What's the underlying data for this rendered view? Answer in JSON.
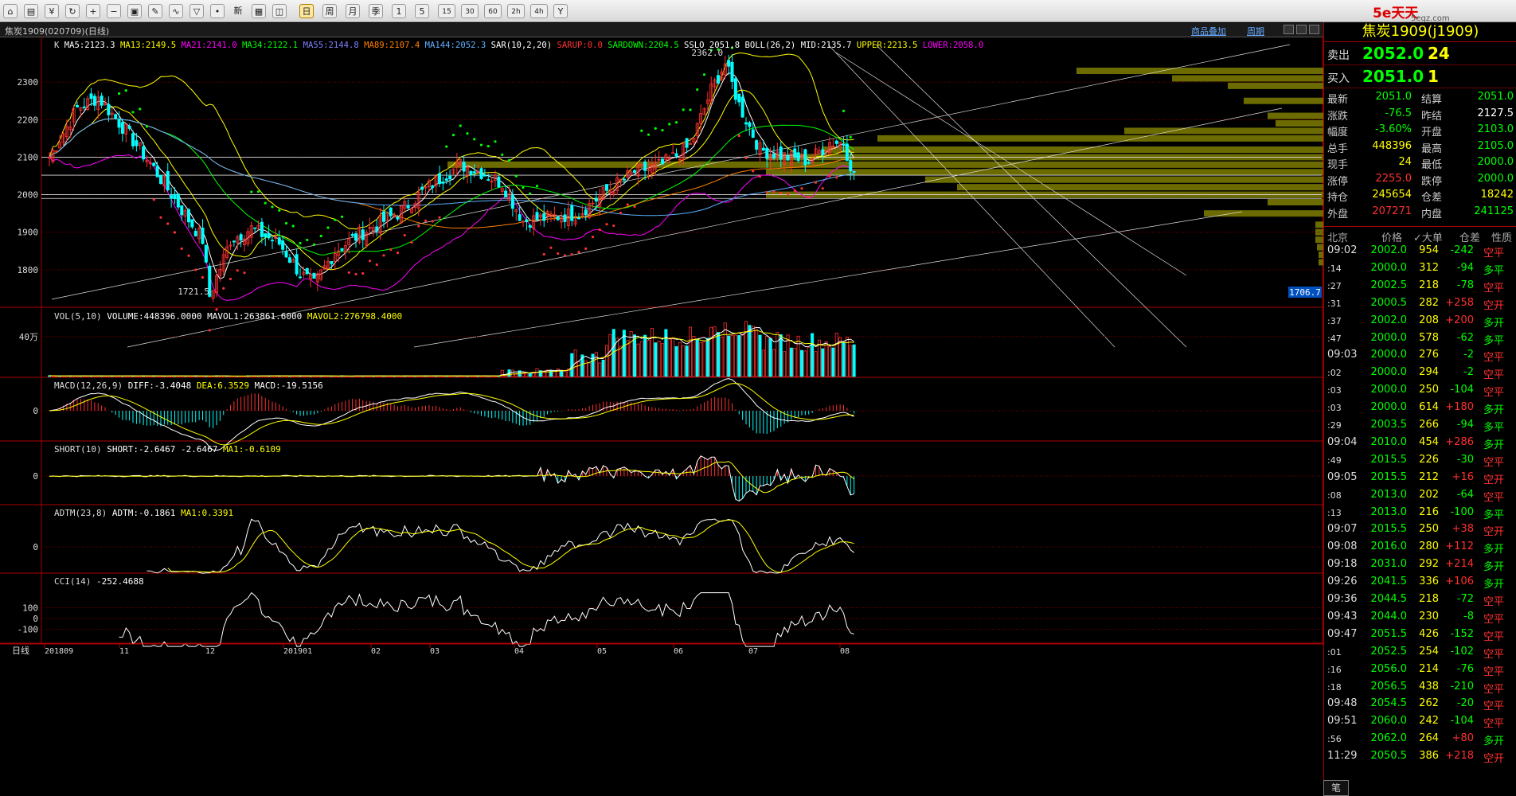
{
  "toolbar": {
    "icons": [
      "home-icon",
      "folder-icon",
      "money-icon",
      "refresh-icon",
      "zoom-in-icon",
      "zoom-out-icon",
      "window-icon",
      "pen-icon",
      "analysis-icon",
      "filter-icon",
      "news-icon",
      "table-icon",
      "multi-chart-icon"
    ],
    "periods": [
      "日",
      "周",
      "月",
      "季",
      "1",
      "5",
      "15",
      "30",
      "60",
      "2h",
      "4h",
      "Y"
    ],
    "selected_period": "日",
    "news_label": "新"
  },
  "logo": {
    "text": "5e天天",
    "domain": "5eqz.com"
  },
  "titlebar": {
    "title": "焦炭1909(020709)(日线)",
    "overlay_link": "商品叠加",
    "cycle_link": "周期"
  },
  "main_panel": {
    "indicator_line_prefix": "K",
    "indicators": [
      {
        "text": "MA5:2123.3",
        "color": "#ffffff"
      },
      {
        "text": "MA13:2149.5",
        "color": "#ffff00"
      },
      {
        "text": "MA21:2141.0",
        "color": "#ff00ff"
      },
      {
        "text": "MA34:2122.1",
        "color": "#00ff00"
      },
      {
        "text": "MA55:2144.8",
        "color": "#7f7fff"
      },
      {
        "text": "MA89:2107.4",
        "color": "#ff8000"
      },
      {
        "text": "MA144:2052.3",
        "color": "#5fb0ff"
      },
      {
        "text": "SAR(10,2,20)",
        "color": "#ffffff"
      },
      {
        "text": "SARUP:0.0",
        "color": "#ff3030"
      },
      {
        "text": "SARDOWN:2204.5",
        "color": "#00ff00"
      },
      {
        "text": "SSLO 2051.8",
        "color": "#ffffff"
      },
      {
        "text": "BOLL(26,2)",
        "color": "#ffffff"
      },
      {
        "text": "MID:2135.7",
        "color": "#ffffff"
      },
      {
        "text": "UPPER:2213.5",
        "color": "#ffff00"
      },
      {
        "text": "LOWER:2058.0",
        "color": "#ff00ff"
      }
    ],
    "y_ticks": [
      "2300",
      "2200",
      "2100",
      "2000",
      "1900",
      "1800"
    ],
    "high_label": "2362.0",
    "low_label": "1721.5",
    "cursor_price": "1706.7"
  },
  "vol_panel": {
    "label": "VOL(5,10)",
    "items": [
      {
        "text": "VOLUME:448396.0000",
        "color": "#ffffff"
      },
      {
        "text": "MAVOL1:263861.6000",
        "color": "#ffffff"
      },
      {
        "text": "MAVOL2:276798.4000",
        "color": "#ffff00"
      }
    ],
    "y_tick": "40万"
  },
  "macd_panel": {
    "label": "MACD(12,26,9)",
    "items": [
      {
        "text": "DIFF:-3.4048",
        "color": "#ffffff"
      },
      {
        "text": "DEA:6.3529",
        "color": "#ffff00"
      },
      {
        "text": "MACD:-19.5156",
        "color": "#ffffff"
      }
    ],
    "y_tick": "0"
  },
  "short_panel": {
    "label": "SHORT(10)",
    "items": [
      {
        "text": "SHORT:-2.6467",
        "color": "#ffffff"
      },
      {
        "text": "-2.6467",
        "color": "#ffffff"
      },
      {
        "text": "MA1:-0.6109",
        "color": "#ffff00"
      }
    ],
    "y_tick": "0"
  },
  "adtm_panel": {
    "label": "ADTM(23,8)",
    "items": [
      {
        "text": "ADTM:-0.1861",
        "color": "#ffffff"
      },
      {
        "text": "MA1:0.3391",
        "color": "#ffff00"
      }
    ],
    "y_tick": "0"
  },
  "cci_panel": {
    "label": "CCI(14)",
    "items": [
      {
        "text": "-252.4688",
        "color": "#ffffff"
      }
    ],
    "y_ticks": [
      "100",
      "0",
      "-100"
    ]
  },
  "x_axis": {
    "prefix": "日线",
    "labels": [
      "201809",
      "11",
      "12",
      "201901",
      "02",
      "03",
      "04",
      "05",
      "06",
      "07",
      "08"
    ]
  },
  "quote": {
    "title": "焦炭1909(j1909)",
    "sell": {
      "label": "卖出",
      "price": "2052.0",
      "vol": "24"
    },
    "buy": {
      "label": "买入",
      "price": "2051.0",
      "vol": "1"
    },
    "stats": [
      {
        "l1": "最新",
        "v1": "2051.0",
        "c1": "#00ff00",
        "l2": "结算",
        "v2": "2051.0",
        "c2": "#00ff00"
      },
      {
        "l1": "涨跌",
        "v1": "-76.5",
        "c1": "#00ff00",
        "l2": "昨结",
        "v2": "2127.5",
        "c2": "#ffffff"
      },
      {
        "l1": "幅度",
        "v1": "-3.60%",
        "c1": "#00ff00",
        "l2": "开盘",
        "v2": "2103.0",
        "c2": "#00ff00"
      },
      {
        "l1": "总手",
        "v1": "448396",
        "c1": "#ffff00",
        "l2": "最高",
        "v2": "2105.0",
        "c2": "#00ff00"
      },
      {
        "l1": "现手",
        "v1": "24",
        "c1": "#ffff00",
        "l2": "最低",
        "v2": "2000.0",
        "c2": "#00ff00"
      },
      {
        "l1": "涨停",
        "v1": "2255.0",
        "c1": "#ff3030",
        "l2": "跌停",
        "v2": "2000.0",
        "c2": "#00ff00"
      },
      {
        "l1": "持仓",
        "v1": "245654",
        "c1": "#ffff00",
        "l2": "仓差",
        "v2": "18242",
        "c2": "#ffff00"
      },
      {
        "l1": "外盘",
        "v1": "207271",
        "c1": "#ff3030",
        "l2": "内盘",
        "v2": "241125",
        "c2": "#00ff00"
      }
    ],
    "tick_header": [
      "北京",
      "价格",
      "✓大单",
      "仓差",
      "性质"
    ],
    "ticks": [
      {
        "t": "09:02",
        "p": "2002.0",
        "v": "954",
        "d": "-242",
        "n": "空平"
      },
      {
        "t": ":14",
        "p": "2000.0",
        "v": "312",
        "d": "-94",
        "n": "多平"
      },
      {
        "t": ":27",
        "p": "2002.5",
        "v": "218",
        "d": "-78",
        "n": "空平"
      },
      {
        "t": ":31",
        "p": "2000.5",
        "v": "282",
        "d": "+258",
        "n": "空开"
      },
      {
        "t": ":37",
        "p": "2002.0",
        "v": "208",
        "d": "+200",
        "n": "多开"
      },
      {
        "t": ":47",
        "p": "2000.0",
        "v": "578",
        "d": "-62",
        "n": "多平"
      },
      {
        "t": "09:03",
        "p": "2000.0",
        "v": "276",
        "d": "-2",
        "n": "空平"
      },
      {
        "t": ":02",
        "p": "2000.0",
        "v": "294",
        "d": "-2",
        "n": "空平"
      },
      {
        "t": ":03",
        "p": "2000.0",
        "v": "250",
        "d": "-104",
        "n": "空平"
      },
      {
        "t": ":03",
        "p": "2000.0",
        "v": "614",
        "d": "+180",
        "n": "多开"
      },
      {
        "t": ":29",
        "p": "2003.5",
        "v": "266",
        "d": "-94",
        "n": "多平"
      },
      {
        "t": "09:04",
        "p": "2010.0",
        "v": "454",
        "d": "+286",
        "n": "多开"
      },
      {
        "t": ":49",
        "p": "2015.5",
        "v": "226",
        "d": "-30",
        "n": "空平"
      },
      {
        "t": "09:05",
        "p": "2015.5",
        "v": "212",
        "d": "+16",
        "n": "空开"
      },
      {
        "t": ":08",
        "p": "2013.0",
        "v": "202",
        "d": "-64",
        "n": "空平"
      },
      {
        "t": ":13",
        "p": "2013.0",
        "v": "216",
        "d": "-100",
        "n": "多平"
      },
      {
        "t": "09:07",
        "p": "2015.5",
        "v": "250",
        "d": "+38",
        "n": "空开"
      },
      {
        "t": "09:08",
        "p": "2016.0",
        "v": "280",
        "d": "+112",
        "n": "多开"
      },
      {
        "t": "09:18",
        "p": "2031.0",
        "v": "292",
        "d": "+214",
        "n": "多开"
      },
      {
        "t": "09:26",
        "p": "2041.5",
        "v": "336",
        "d": "+106",
        "n": "多开"
      },
      {
        "t": "09:36",
        "p": "2044.5",
        "v": "218",
        "d": "-72",
        "n": "空平"
      },
      {
        "t": "09:43",
        "p": "2044.0",
        "v": "230",
        "d": "-8",
        "n": "空平"
      },
      {
        "t": "09:47",
        "p": "2051.5",
        "v": "426",
        "d": "-152",
        "n": "空平"
      },
      {
        "t": ":01",
        "p": "2052.5",
        "v": "254",
        "d": "-102",
        "n": "空平"
      },
      {
        "t": ":16",
        "p": "2056.0",
        "v": "214",
        "d": "-76",
        "n": "空平"
      },
      {
        "t": ":18",
        "p": "2056.5",
        "v": "438",
        "d": "-210",
        "n": "空平"
      },
      {
        "t": "09:48",
        "p": "2054.5",
        "v": "262",
        "d": "-20",
        "n": "空平"
      },
      {
        "t": "09:51",
        "p": "2060.0",
        "v": "242",
        "d": "-104",
        "n": "空平"
      },
      {
        "t": ":56",
        "p": "2062.0",
        "v": "264",
        "d": "+80",
        "n": "多开"
      },
      {
        "t": "11:29",
        "p": "2050.5",
        "v": "386",
        "d": "+218",
        "n": "空开"
      }
    ],
    "bottom_tab": "笔"
  },
  "colors": {
    "up": "#ff3030",
    "down": "#00ffff",
    "grid": "#800000",
    "text": "#dddddd",
    "profile": "#6b6b00"
  }
}
